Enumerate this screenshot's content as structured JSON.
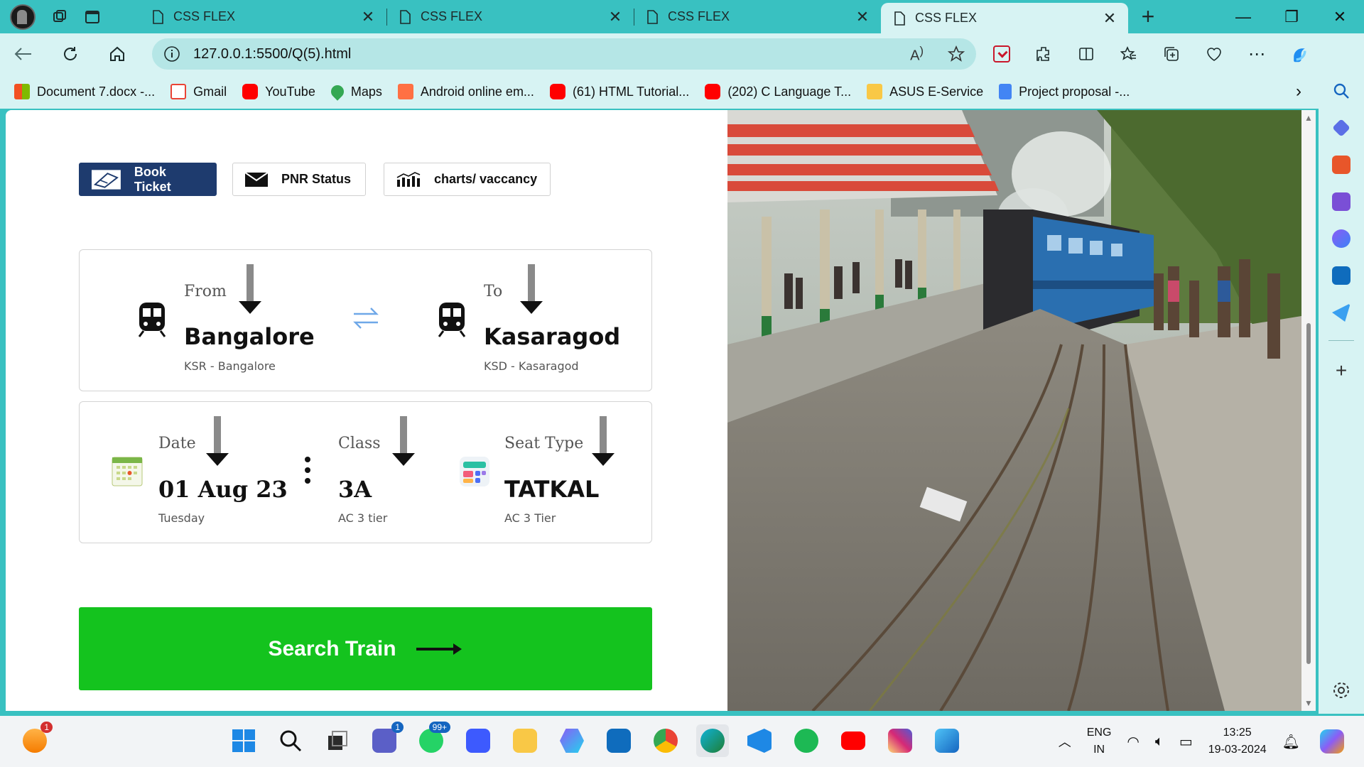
{
  "browser": {
    "tabs": [
      {
        "title": "CSS FLEX",
        "active": false
      },
      {
        "title": "CSS FLEX",
        "active": false
      },
      {
        "title": "CSS FLEX",
        "active": false
      },
      {
        "title": "CSS FLEX",
        "active": true
      }
    ],
    "url": "127.0.0.1:5500/Q(5).html",
    "bookmarks": [
      {
        "label": "Document 7.docx -...",
        "color": "#f25022"
      },
      {
        "label": "Gmail",
        "color": "#ea4335"
      },
      {
        "label": "YouTube",
        "color": "#ff0000"
      },
      {
        "label": "Maps",
        "color": "#34a853"
      },
      {
        "label": "Android online em...",
        "color": "#ff7043"
      },
      {
        "label": "(61) HTML Tutorial...",
        "color": "#ff0000"
      },
      {
        "label": "(202) C Language T...",
        "color": "#ff0000"
      },
      {
        "label": "ASUS E-Service",
        "color": "#f9c846"
      },
      {
        "label": "Project proposal -...",
        "color": "#4285f4"
      }
    ]
  },
  "page": {
    "segments": {
      "book_ticket": "Book Ticket",
      "pnr_status": "PNR Status",
      "charts": "charts/ vaccancy"
    },
    "route": {
      "from_label": "From",
      "from_city": "Bangalore",
      "from_code": "KSR - Bangalore",
      "to_label": "To",
      "to_city": "Kasaragod",
      "to_code": "KSD - Kasaragod"
    },
    "details": {
      "date_label": "Date",
      "date_value": "01 Aug 23",
      "date_sub": "Tuesday",
      "class_label": "Class",
      "class_value": "3A",
      "class_sub": "AC 3 tier",
      "seat_label": "Seat Type",
      "seat_value": "TATKAL",
      "seat_sub": "AC 3 Tier"
    },
    "search_button": "Search Train"
  },
  "taskbar": {
    "notification_count": "1",
    "teams_badge": "1",
    "whatsapp_badge": "99+",
    "language": "ENG",
    "region": "IN",
    "time": "13:25",
    "date": "19-03-2024"
  },
  "colors": {
    "browser_teal": "#39c1c1",
    "chrome_light": "#d7f3f3",
    "active_segment": "#1e3b6e",
    "search_green": "#14c31e"
  }
}
